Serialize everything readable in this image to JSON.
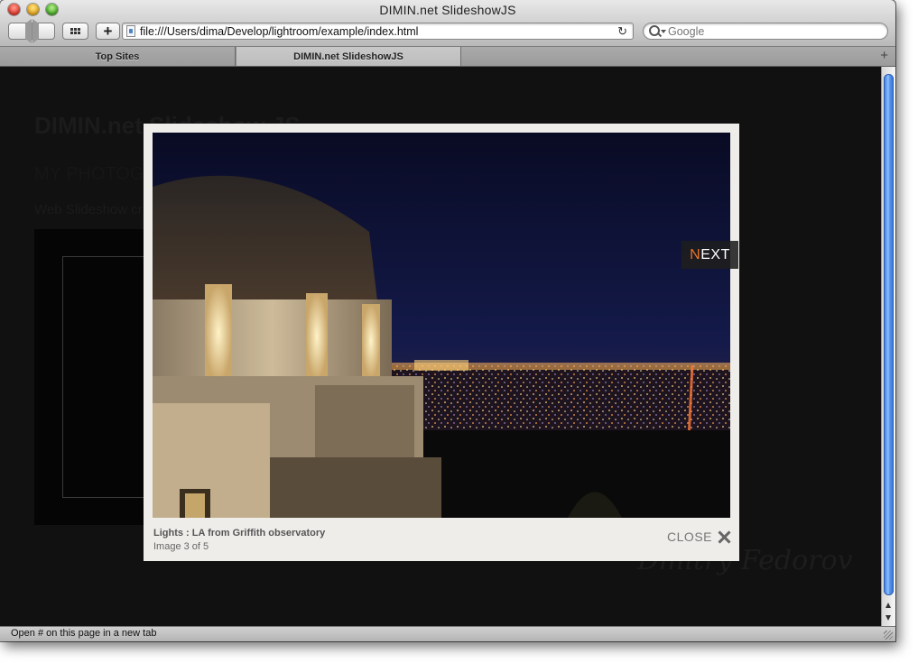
{
  "window": {
    "title": "DIMIN.net SlideshowJS"
  },
  "toolbar": {
    "url": "file:///Users/dima/Develop/lightroom/example/index.html",
    "search_placeholder": "Google",
    "new_tab_symbol": "+",
    "reload_symbol": "↻"
  },
  "tabs": [
    {
      "label": "Top Sites",
      "active": false
    },
    {
      "label": "DIMIN.net SlideshowJS",
      "active": true
    }
  ],
  "page": {
    "title": "DIMIN.net Slideshow JS",
    "subtitle": "MY PHOTOG",
    "intro": "Web Slideshow cr",
    "signature": "Dmitry Fedorov"
  },
  "lightbox": {
    "caption_title": "Lights : LA from Griffith observatory",
    "caption_count": "Image 3 of 5",
    "close_label": "CLOSE",
    "next_label_first": "N",
    "next_label_rest": "EXT",
    "accent_color": "#e8742a"
  },
  "status": {
    "text": "Open # on this page in a new tab"
  },
  "colors": {
    "scroll_thumb": "#4a8ae6",
    "overlay": "#111111",
    "lightbox_bg": "#efedea"
  }
}
